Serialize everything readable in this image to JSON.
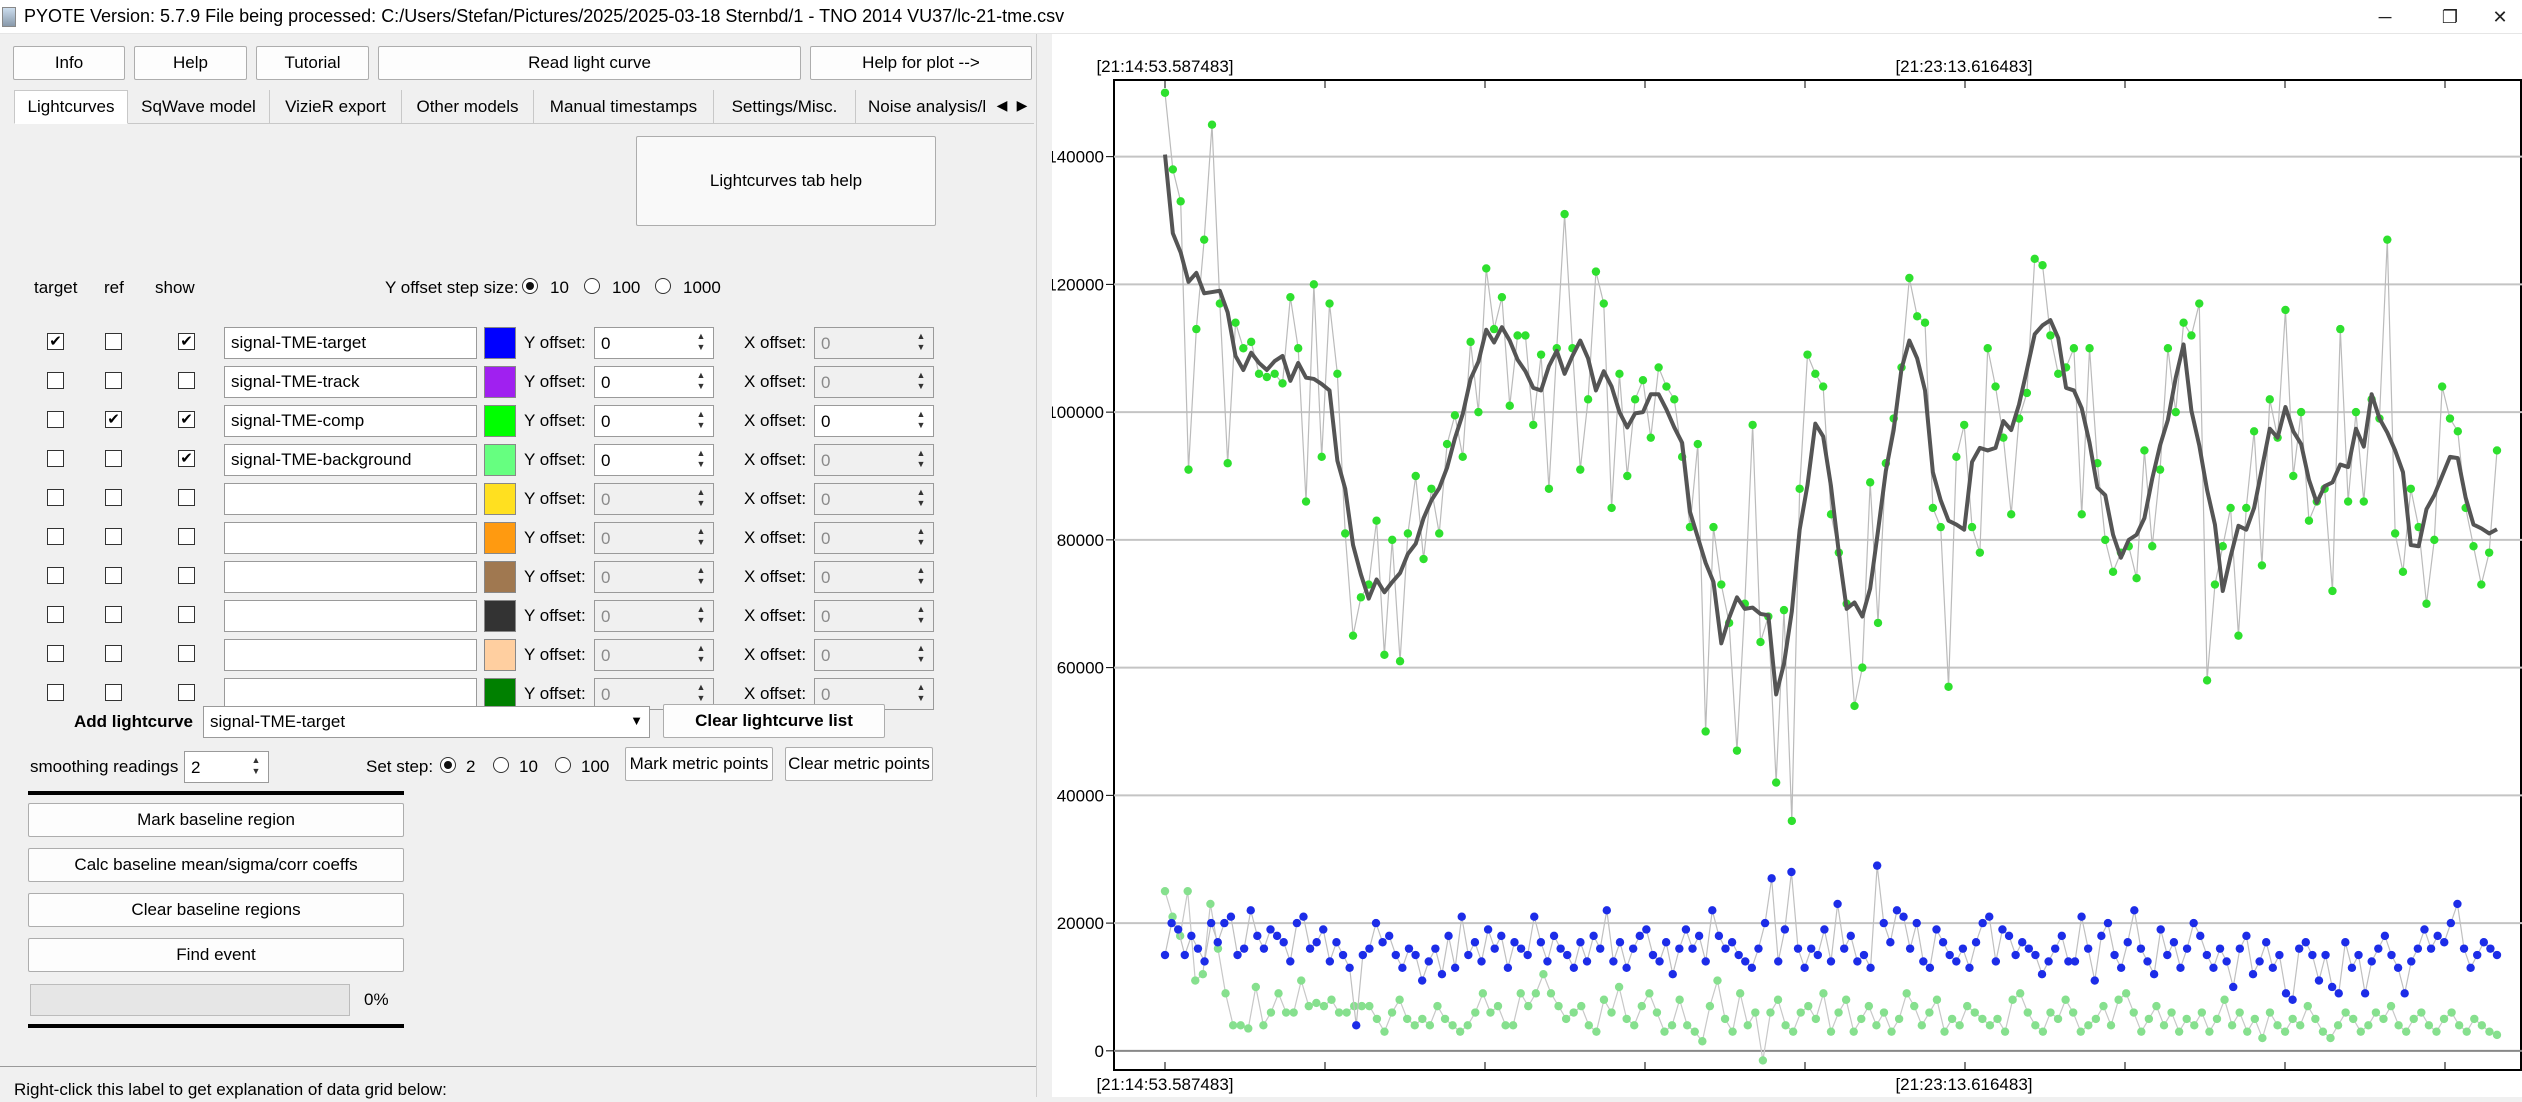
{
  "window": {
    "title": "PYOTE Version: 5.7.9  File being processed: C:/Users/Stefan/Pictures/2025/2025-03-18 Sternbd/1 - TNO 2014 VU37/lc-21-tme.csv",
    "minimize": "─",
    "restore": "❐",
    "close": "✕"
  },
  "toolbar": {
    "info": "Info",
    "help": "Help",
    "tutorial": "Tutorial",
    "read_light_curve": "Read light curve",
    "help_for_plot": "Help for plot -->"
  },
  "tabs": [
    {
      "label": "Lightcurves",
      "active": true
    },
    {
      "label": "SqWave model"
    },
    {
      "label": "VizieR export"
    },
    {
      "label": "Other models"
    },
    {
      "label": "Manual timestamps"
    },
    {
      "label": "Settings/Misc."
    },
    {
      "label": "Noise analysis/l"
    }
  ],
  "lightcurves_tab_help": "Lightcurves tab help",
  "columns": {
    "target": "target",
    "ref": "ref",
    "show": "show"
  },
  "y_offset_step": {
    "label": "Y offset step size:",
    "options": [
      "10",
      "100",
      "1000"
    ],
    "selected": "10"
  },
  "y_offset_label": "Y offset:",
  "x_offset_label": "X offset:",
  "rows": [
    {
      "name": "signal-TME-target",
      "color": "#0000ff",
      "target": true,
      "ref": false,
      "show": true,
      "y": "0",
      "x": "0",
      "y_enabled": true,
      "x_enabled": false
    },
    {
      "name": "signal-TME-track",
      "color": "#a020f0",
      "target": false,
      "ref": false,
      "show": false,
      "y": "0",
      "x": "0",
      "y_enabled": true,
      "x_enabled": false
    },
    {
      "name": "signal-TME-comp",
      "color": "#00ff00",
      "target": false,
      "ref": true,
      "show": true,
      "y": "0",
      "x": "0",
      "y_enabled": true,
      "x_enabled": true
    },
    {
      "name": "signal-TME-background",
      "color": "#66ff80",
      "target": false,
      "ref": false,
      "show": true,
      "y": "0",
      "x": "0",
      "y_enabled": true,
      "x_enabled": false
    },
    {
      "name": "",
      "color": "#ffe020",
      "target": false,
      "ref": false,
      "show": false,
      "y": "0",
      "x": "0",
      "y_enabled": false,
      "x_enabled": false
    },
    {
      "name": "",
      "color": "#ff9a10",
      "target": false,
      "ref": false,
      "show": false,
      "y": "0",
      "x": "0",
      "y_enabled": false,
      "x_enabled": false
    },
    {
      "name": "",
      "color": "#a07850",
      "target": false,
      "ref": false,
      "show": false,
      "y": "0",
      "x": "0",
      "y_enabled": false,
      "x_enabled": false
    },
    {
      "name": "",
      "color": "#333333",
      "target": false,
      "ref": false,
      "show": false,
      "y": "0",
      "x": "0",
      "y_enabled": false,
      "x_enabled": false
    },
    {
      "name": "",
      "color": "#ffcfa0",
      "target": false,
      "ref": false,
      "show": false,
      "y": "0",
      "x": "0",
      "y_enabled": false,
      "x_enabled": false
    },
    {
      "name": "",
      "color": "#008000",
      "target": false,
      "ref": false,
      "show": false,
      "y": "0",
      "x": "0",
      "y_enabled": false,
      "x_enabled": false
    }
  ],
  "add_lightcurve": {
    "label": "Add lightcurve",
    "selected": "signal-TME-target"
  },
  "clear_lightcurve_list": "Clear lightcurve list",
  "smoothing": {
    "label": "smoothing readings",
    "value": "2"
  },
  "set_step": {
    "label": "Set step:",
    "options": [
      "2",
      "10",
      "100"
    ],
    "selected": "2"
  },
  "mark_metric_points": "Mark metric points",
  "clear_metric_points": "Clear metric points",
  "mark_baseline_region": "Mark baseline region",
  "calc_baseline": "Calc baseline mean/sigma/corr coeffs",
  "clear_baseline_regions": "Clear baseline regions",
  "find_event": "Find event",
  "progress": {
    "value": 0,
    "text": "0%"
  },
  "data_grid_hint": "Right-click this label to get explanation of data grid below:",
  "chart_data": {
    "type": "scatter",
    "top_axis_labels": [
      "[21:14:53.587483]",
      "[21:23:13.616483]"
    ],
    "bottom_axis_labels": [
      "[21:14:53.587483]",
      "[21:23:13.616483]"
    ],
    "y_ticks": [
      "0",
      "20000",
      "40000",
      "60000",
      "80000",
      "100000",
      "120000",
      "140000"
    ],
    "ylim": [
      -3000,
      152000
    ],
    "grid": true,
    "colors": {
      "comp_points": "#2ee02e",
      "comp_line": "#bbbbbb",
      "smoothed": "#555555",
      "target_points": "#1c2ce8",
      "target_line": "#c0c0c0",
      "background_points": "#86e08e",
      "background_line": "#c8c8c8"
    },
    "series": [
      {
        "name": "signal-TME-comp",
        "values": [
          150000,
          138000,
          133000,
          91000,
          113000,
          127000,
          145000,
          117000,
          92000,
          114000,
          110000,
          111000,
          106000,
          105500,
          106000,
          104500,
          118000,
          110000,
          86000,
          120000,
          93000,
          117000,
          106000,
          81000,
          65000,
          71000,
          73000,
          83000,
          62000,
          80000,
          61000,
          81000,
          90000,
          77000,
          88000,
          81000,
          95000,
          99500,
          93000,
          111000,
          100000,
          122500,
          113000,
          118000,
          101000,
          112000,
          112000,
          98000,
          109000,
          88000,
          110000,
          131000,
          110000,
          91000,
          102000,
          122000,
          117000,
          85000,
          106000,
          90000,
          102000,
          105000,
          96000,
          107000,
          104000,
          102000,
          93000,
          82000,
          95000,
          50000,
          82000,
          73000,
          67000,
          47000,
          70000,
          98000,
          64000,
          68000,
          42000,
          69000,
          36000,
          88000,
          109000,
          106000,
          104000,
          84000,
          78000,
          70000,
          54000,
          60000,
          89000,
          67000,
          92000,
          99000,
          107000,
          121000,
          115000,
          114000,
          85000,
          82000,
          57000,
          93000,
          98000,
          82000,
          78000,
          110000,
          104000,
          96000,
          84000,
          99000,
          103000,
          124000,
          123000,
          112000,
          106000,
          107000,
          110000,
          84000,
          110000,
          92000,
          80000,
          75000,
          78000,
          79000,
          74000,
          94000,
          79000,
          91000,
          110000,
          100000,
          114000,
          112000,
          117000,
          58000,
          73000,
          79000,
          85000,
          65000,
          85000,
          97000,
          76000,
          102000,
          96000,
          116000,
          90000,
          100000,
          83000,
          86000,
          88000,
          72000,
          113000,
          86000,
          100000,
          86000,
          102000,
          99000,
          127000,
          81000,
          75000,
          88000,
          82000,
          70000,
          80000,
          104000,
          99000,
          97000,
          85000,
          79000,
          73000,
          78000,
          94000
        ]
      },
      {
        "name": "signal-TME-target",
        "values": [
          15000,
          20000,
          19000,
          15000,
          18000,
          16000,
          14000,
          20000,
          17000,
          20000,
          21000,
          15000,
          16000,
          22000,
          18000,
          16000,
          19000,
          18000,
          17000,
          14000,
          20000,
          21000,
          16000,
          17000,
          19000,
          14000,
          17000,
          15000,
          13000,
          4000,
          15000,
          16000,
          20000,
          17000,
          18000,
          15000,
          13000,
          16000,
          15000,
          11000,
          14000,
          16000,
          12000,
          18000,
          13000,
          21000,
          15000,
          17000,
          14000,
          19000,
          16000,
          18000,
          13000,
          17000,
          16000,
          15000,
          21000,
          17000,
          14000,
          18000,
          16000,
          15000,
          13000,
          17000,
          14000,
          18000,
          16000,
          22000,
          14000,
          17000,
          13000,
          16000,
          18000,
          19000,
          15000,
          14000,
          17000,
          12000,
          16000,
          19000,
          16000,
          18000,
          14000,
          22000,
          18000,
          16000,
          17000,
          15000,
          14000,
          13000,
          16000,
          20000,
          27000,
          14000,
          19000,
          28000,
          16000,
          13000,
          16000,
          15000,
          19000,
          14000,
          23000,
          16000,
          18000,
          14000,
          15000,
          13000,
          29000,
          20000,
          17000,
          22000,
          21000,
          16000,
          20000,
          14000,
          13000,
          19000,
          17000,
          15000,
          14000,
          16000,
          13000,
          17000,
          20000,
          21000,
          14000,
          19000,
          18000,
          15000,
          17000,
          16000,
          15000,
          12000,
          14000,
          16000,
          18000,
          14000,
          14000,
          21000,
          16000,
          11000,
          18000,
          20000,
          15000,
          13000,
          17000,
          22000,
          16000,
          14000,
          12000,
          19000,
          15000,
          17000,
          13000,
          16000,
          20000,
          18000,
          15000,
          13000,
          16000,
          14000,
          10000,
          16000,
          18000,
          12000,
          14000,
          17000,
          13000,
          15000,
          9000,
          8000,
          16000,
          17000,
          15000,
          11000,
          15000,
          10000,
          9000,
          17000,
          13000,
          15000,
          9000,
          14000,
          16000,
          18000,
          15000,
          13000,
          9000,
          14000,
          16000,
          19000,
          16000,
          18000,
          17000,
          20000,
          23000,
          16000,
          13000,
          15000,
          17000,
          16000,
          15000
        ]
      },
      {
        "name": "signal-TME-background",
        "values": [
          25000,
          21000,
          18000,
          25000,
          11000,
          12000,
          23000,
          16000,
          9000,
          4000,
          4000,
          3500,
          10000,
          4000,
          6000,
          9000,
          6000,
          6000,
          11000,
          7000,
          7500,
          7000,
          8000,
          6000,
          6000,
          7000,
          7000,
          7000,
          5000,
          3000,
          6000,
          8000,
          5000,
          4000,
          5000,
          4000,
          7000,
          5000,
          4000,
          3000,
          4000,
          6000,
          9000,
          6000,
          7000,
          4000,
          4000,
          9000,
          7000,
          9000,
          12000,
          9000,
          7000,
          5000,
          6000,
          7000,
          4000,
          3000,
          8000,
          6000,
          10000,
          5000,
          4000,
          7000,
          9000,
          6000,
          3000,
          4000,
          8000,
          4000,
          3000,
          1500,
          7000,
          11000,
          5000,
          3000,
          9000,
          4000,
          6000,
          -1500,
          6000,
          8000,
          4000,
          3000,
          6000,
          7000,
          5000,
          9000,
          3000,
          6000,
          8000,
          3000,
          5000,
          7000,
          4000,
          6000,
          3000,
          5000,
          9000,
          7000,
          4000,
          6000,
          8000,
          3000,
          5000,
          4000,
          7000,
          6000,
          5000,
          4000,
          5000,
          3000,
          8000,
          9000,
          6000,
          4000,
          3000,
          6000,
          5000,
          8000,
          6000,
          3000,
          4000,
          5000,
          7000,
          4000,
          8000,
          9000,
          6000,
          3000,
          5000,
          7000,
          4000,
          6000,
          3000,
          5000,
          4000,
          6000,
          3000,
          5000,
          8000,
          4000,
          6000,
          3000,
          5000,
          2000,
          6000,
          4000,
          3000,
          5000,
          4000,
          7000,
          5000,
          3000,
          2000,
          4000,
          6000,
          5000,
          3000,
          4000,
          6000,
          5000,
          7000,
          4000,
          3000,
          5000,
          6000,
          4000,
          3000,
          5000,
          6000,
          4000,
          3000,
          5000,
          4000,
          3000,
          2500
        ]
      }
    ]
  }
}
